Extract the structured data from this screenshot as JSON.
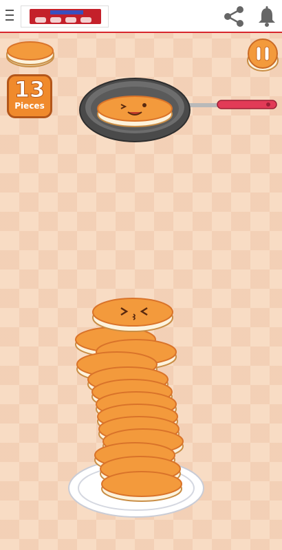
{
  "header": {
    "banner_icon": "game-banner-logo",
    "menu_icon": "hamburger-menu-icon",
    "share_icon": "share-icon",
    "notifications_icon": "bell-icon"
  },
  "game": {
    "pieces_count": "13",
    "pieces_label": "Pieces",
    "pause_icon": "pause-icon",
    "colors": {
      "accent_orange": "#f08a2c",
      "pancake_top": "#f39a3c",
      "pancake_cream": "#fdf3dd",
      "background": "#f8dcc4",
      "header_line": "#d7252c"
    }
  }
}
